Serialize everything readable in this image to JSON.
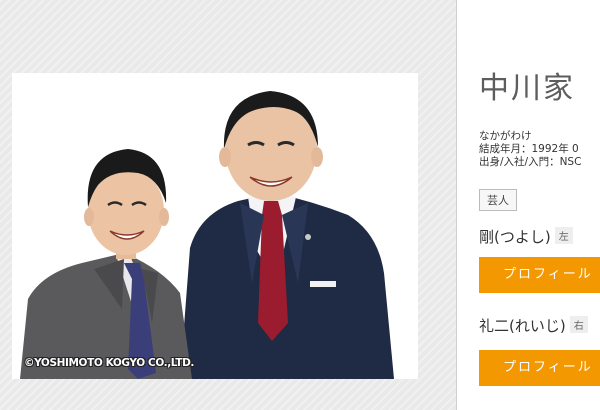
{
  "photo": {
    "copyright": "©YOSHIMOTO KOGYO CO.,LTD."
  },
  "profile": {
    "name": "中川家",
    "reading": "なかがわけ",
    "formed": "結成年月：1992年 0",
    "origin": "出身/入社/入門：NSC",
    "tag": "芸人",
    "members": [
      {
        "name": "剛(つよし)",
        "position": "左",
        "button_label": "プロフィール"
      },
      {
        "name": "礼二(れいじ)",
        "position": "右",
        "button_label": "プロフィール"
      }
    ]
  },
  "colors": {
    "accent": "#f39800",
    "title": "#5d5d5d"
  }
}
